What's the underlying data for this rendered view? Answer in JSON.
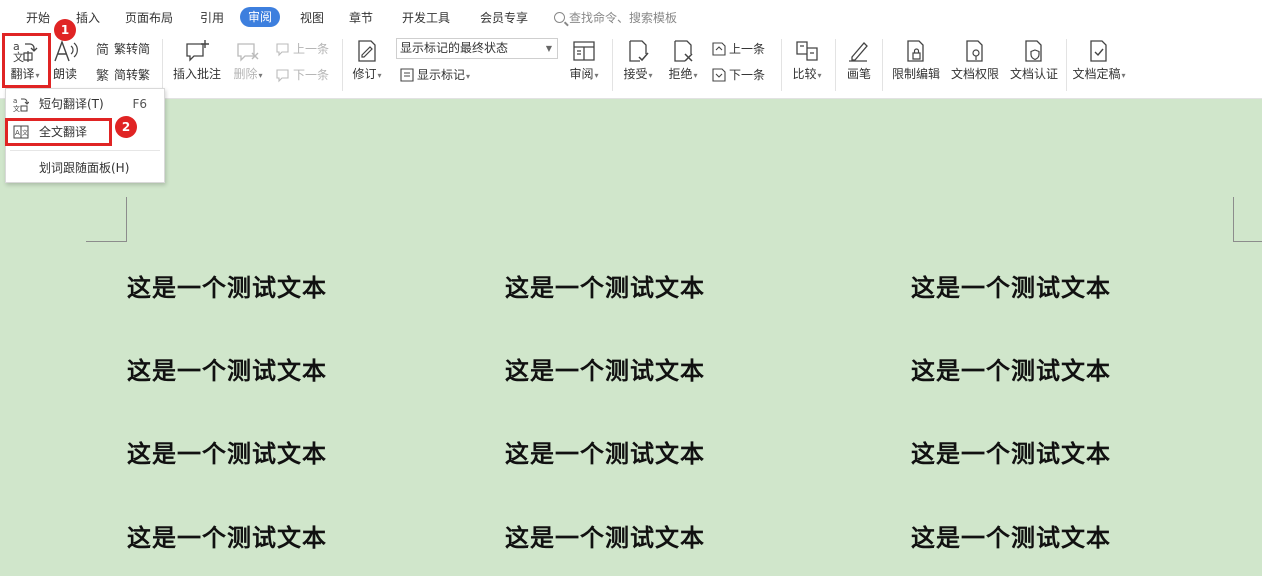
{
  "tabs": [
    {
      "label": "开始",
      "active": false
    },
    {
      "label": "插入",
      "active": false
    },
    {
      "label": "页面布局",
      "active": false
    },
    {
      "label": "引用",
      "active": false
    },
    {
      "label": "审阅",
      "active": true
    },
    {
      "label": "视图",
      "active": false
    },
    {
      "label": "章节",
      "active": false
    },
    {
      "label": "开发工具",
      "active": false
    },
    {
      "label": "会员专享",
      "active": false
    }
  ],
  "search": {
    "label": "查找命令、搜索模板"
  },
  "ribbon": {
    "translate": "翻译",
    "read_aloud": "朗读",
    "trad_to_simp": "繁转简",
    "simp_to_trad": "简转繁",
    "insert_comment": "插入批注",
    "delete": "删除",
    "prev_comment": "上一条",
    "next_comment": "下一条",
    "revise": "修订",
    "markup_state": "显示标记的最终状态",
    "show_markup": "显示标记",
    "review": "审阅",
    "accept": "接受",
    "reject": "拒绝",
    "prev_change": "上一条",
    "next_change": "下一条",
    "compare": "比较",
    "pen": "画笔",
    "restrict_edit": "限制编辑",
    "doc_rights": "文档权限",
    "doc_auth": "文档认证",
    "doc_finalize": "文档定稿"
  },
  "dropdown": {
    "items": [
      {
        "label": "短句翻译(T)",
        "shortcut": "F6"
      },
      {
        "label": "全文翻译",
        "shortcut": ""
      },
      {
        "label": "划词跟随面板(H)",
        "shortcut": ""
      }
    ]
  },
  "badges": {
    "one": "1",
    "two": "2"
  },
  "document": {
    "rows": [
      [
        "这是一个测试文本",
        "这是一个测试文本",
        "这是一个测试文本"
      ],
      [
        "这是一个测试文本",
        "这是一个测试文本",
        "这是一个测试文本"
      ],
      [
        "这是一个测试文本",
        "这是一个测试文本",
        "这是一个测试文本"
      ],
      [
        "这是一个测试文本",
        "这是一个测试文本",
        "这是一个测试文本"
      ]
    ]
  },
  "colors": {
    "accent": "#3d7fde",
    "highlight": "#e02424",
    "page": "#d0e6cb"
  }
}
